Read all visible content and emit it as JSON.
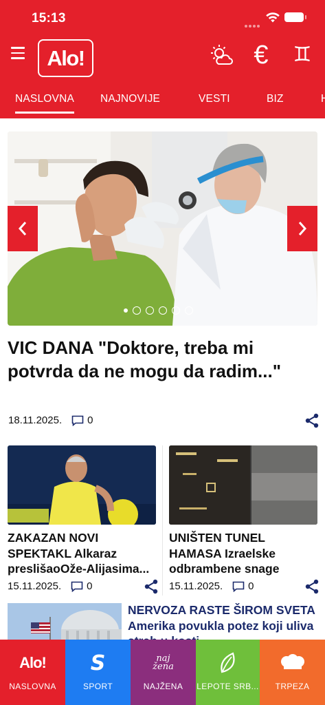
{
  "status_bar": {
    "time": "15:13"
  },
  "header": {
    "logo_text": "Alo!",
    "euro_symbol": "€",
    "gemini_symbol": "♊",
    "icons": [
      "menu-icon",
      "weather-icon",
      "euro-icon",
      "horoscope-gemini-icon"
    ],
    "background": "#e4202b"
  },
  "tabs": [
    {
      "label": "NASLOVNA",
      "active": true
    },
    {
      "label": "NAJNOVIJE"
    },
    {
      "label": "VESTI"
    },
    {
      "label": "BIZ"
    },
    {
      "label": "H"
    }
  ],
  "hero": {
    "title": "VIC DANA \"Doktore, treba mi potvrda da ne mogu da radim...\"",
    "date": "18.11.2025.",
    "comments": "0",
    "slide_count": 6,
    "active_slide": 1
  },
  "cards": [
    {
      "title": "ZAKAZAN NOVI SPEKTAKL Alkaraz preslišaoOže-Alijasima...",
      "date": "15.11.2025.",
      "comments": "0"
    },
    {
      "title": "UNIŠTEN TUNEL HAMASA Izraelske odbrambene snage izvele...",
      "date": "15.11.2025.",
      "comments": "0"
    }
  ],
  "row3": {
    "title": "NERVOZA RASTE ŠIROM SVETA Amerika povukla potez koji uliva strah u kosti"
  },
  "bottom_nav": [
    {
      "label": "NASLOVNA",
      "logo": "Alo!",
      "color": "#e4202b"
    },
    {
      "label": "SPORT",
      "logo": "S",
      "color": "#1e7cf2"
    },
    {
      "label": "NAJŽENA",
      "logo": "naj žena",
      "color": "#8b2e7d"
    },
    {
      "label": "LEPOTE SRB...",
      "logo": "leaf",
      "color": "#6fbf3b"
    },
    {
      "label": "TRPEZA",
      "logo": "chef-hat",
      "color": "#f26b2c"
    }
  ]
}
